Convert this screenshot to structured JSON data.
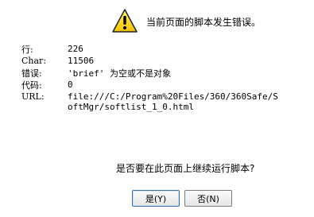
{
  "dialog": {
    "title": "当前页面的脚本发生错误。",
    "icon": "warning-icon",
    "fields": [
      {
        "label": "行:",
        "value": "226"
      },
      {
        "label": "Char:",
        "value": "11506"
      },
      {
        "label": "错误:",
        "value": "'brief' 为空或不是对象"
      },
      {
        "label": "代码:",
        "value": "0"
      },
      {
        "label": "URL:",
        "value": "file:///C:/Program%20Files/360/360Safe/SoftMgr/softlist_1_0.html"
      }
    ],
    "question": "是否要在此页面上继续运行脚本?",
    "buttons": {
      "yes": "是(Y)",
      "no": "否(N)"
    }
  }
}
